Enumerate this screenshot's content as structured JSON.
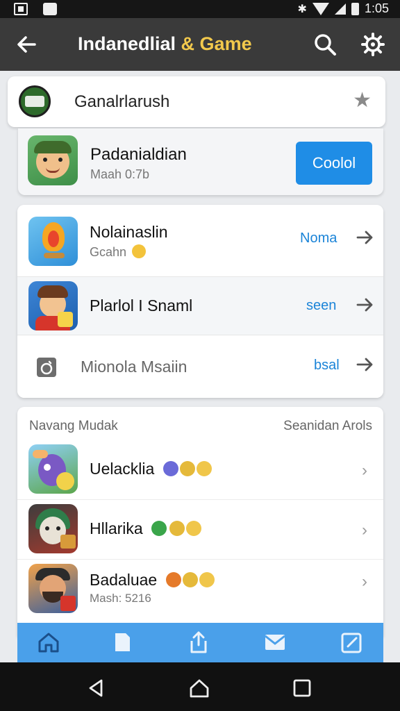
{
  "status_bar": {
    "time": "1:05"
  },
  "app_bar": {
    "title_main": "Indanedlial",
    "title_accent": "& Game"
  },
  "search_card": {
    "text": "Ganalrlarush"
  },
  "featured": {
    "title": "Padanialdian",
    "subtitle": "Maah 0:7b",
    "button_label": "Coolol"
  },
  "list": {
    "items": [
      {
        "title": "Nolainaslin",
        "subtitle": "Gcahn",
        "action": "Noma"
      },
      {
        "title": "Plarlol I Snaml",
        "action": "seen"
      },
      {
        "title": "Mionola Msaiin",
        "action": "bsal"
      }
    ]
  },
  "section": {
    "header_left": "Navang Mudak",
    "header_right": "Seanidan Arols",
    "items": [
      {
        "title": "Uelacklia"
      },
      {
        "title": "Hllarika"
      },
      {
        "title": "Badaluae",
        "subtitle": "Mash: 5216"
      }
    ]
  },
  "colors": {
    "accent_blue": "#1f8de6",
    "title_yellow": "#f2c94c",
    "appbar": "#3a3a3a",
    "tabbar": "#4aa0ea"
  }
}
